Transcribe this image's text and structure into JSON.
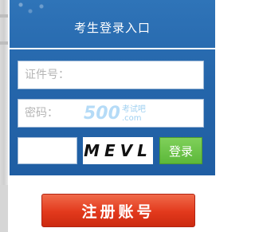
{
  "login_panel": {
    "title": "考生登录入口",
    "id_field": {
      "placeholder": "证件号：",
      "value": ""
    },
    "password_field": {
      "placeholder": "密码：",
      "value": ""
    },
    "captcha_field": {
      "value": ""
    },
    "captcha_code": "MEVL",
    "login_label": "登录"
  },
  "watermark": {
    "number": "500",
    "text_top": "考试吧",
    "text_bottom": ".com"
  },
  "register_label": "注册账号",
  "colors": {
    "panel_blue": "#2566ab",
    "login_green": "#5cb83a",
    "register_red": "#e2391c"
  }
}
